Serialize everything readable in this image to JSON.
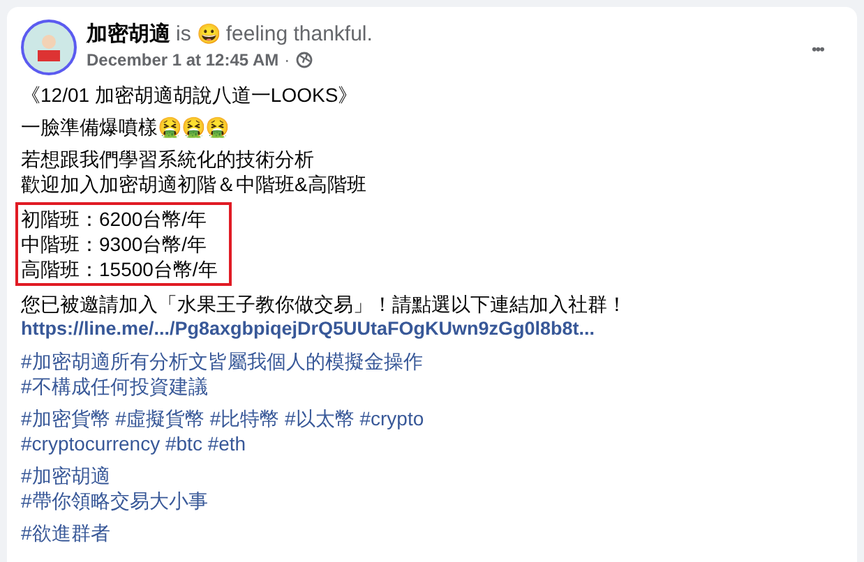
{
  "post": {
    "author": "加密胡適",
    "verb": "is",
    "feeling_emoji": "😀",
    "feeling": "feeling thankful.",
    "timestamp": "December 1 at 12:45 AM",
    "separator": "·",
    "more_menu": "•••",
    "paragraphs": [
      {
        "kind": "text",
        "highlighted": false,
        "lines": [
          "《12/01 加密胡適胡說八道一LOOKS》"
        ]
      },
      {
        "kind": "text",
        "highlighted": false,
        "lines": [
          "一臉準備爆噴樣🤮🤮🤮"
        ]
      },
      {
        "kind": "text",
        "highlighted": false,
        "lines": [
          "若想跟我們學習系統化的技術分析",
          "歡迎加入加密胡適初階＆中階班&高階班"
        ]
      },
      {
        "kind": "text",
        "highlighted": true,
        "lines": [
          "初階班：6200台幣/年",
          "中階班：9300台幣/年",
          "高階班：15500台幣/年"
        ]
      },
      {
        "kind": "mixed",
        "highlighted": false,
        "lines": [
          "您已被邀請加入「水果王子教你做交易」！請點選以下連結加入社群！"
        ],
        "link": "https://line.me/.../Pg8axgbpiqejDrQ5UUtaFOgKUwn9zGg0l8b8t..."
      },
      {
        "kind": "hashtags",
        "highlighted": false,
        "lines": [
          "#加密胡適所有分析文皆屬我個人的模擬金操作",
          "#不構成任何投資建議"
        ]
      },
      {
        "kind": "hashtags",
        "highlighted": false,
        "lines": [
          "#加密貨幣 #虛擬貨幣 #比特幣 #以太幣 #crypto",
          "#cryptocurrency #btc #eth"
        ]
      },
      {
        "kind": "hashtags",
        "highlighted": false,
        "lines": [
          "#加密胡適",
          "#帶你領略交易大小事"
        ]
      },
      {
        "kind": "hashtags",
        "highlighted": false,
        "lines": [
          "#欲進群者"
        ]
      }
    ]
  }
}
